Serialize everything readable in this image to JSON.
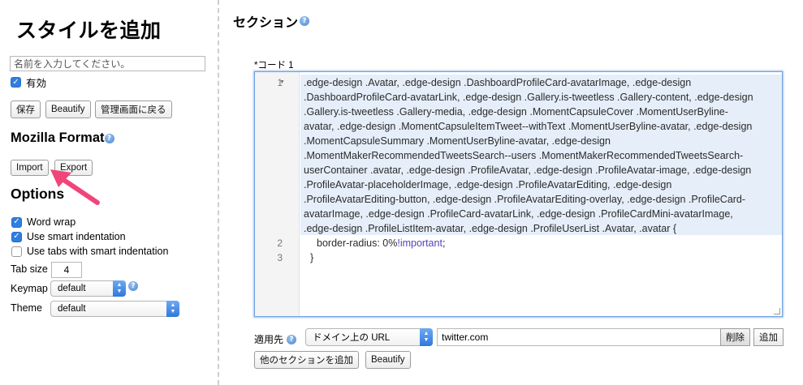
{
  "sidebar": {
    "title": "スタイルを追加",
    "name_placeholder": "名前を入力してください。",
    "enabled_label": "有効",
    "buttons": {
      "save": "保存",
      "beautify": "Beautify",
      "back": "管理画面に戻る"
    },
    "mozilla_format": {
      "heading": "Mozilla Format",
      "import": "Import",
      "export": "Export"
    },
    "options": {
      "heading": "Options",
      "word_wrap": "Word wrap",
      "smart_indent": "Use smart indentation",
      "tabs_smart_indent": "Use tabs with smart indentation",
      "tab_size_label": "Tab size",
      "tab_size_value": "4",
      "keymap_label": "Keymap",
      "keymap_value": "default",
      "theme_label": "Theme",
      "theme_value": "default"
    }
  },
  "main": {
    "title": "セクション",
    "code_label": "*コード 1",
    "line_numbers": [
      "1",
      "2",
      "3"
    ],
    "code_lines": [
      ".edge-design .Avatar, .edge-design .DashboardProfileCard-avatarImage, .edge-design",
      ".DashboardProfileCard-avatarLink, .edge-design .Gallery.is-tweetless .Gallery-content, .edge-design",
      ".Gallery.is-tweetless .Gallery-media, .edge-design .MomentCapsuleCover .MomentUserByline-",
      "avatar, .edge-design .MomentCapsuleItemTweet--withText .MomentUserByline-avatar, .edge-design",
      ".MomentCapsuleSummary .MomentUserByline-avatar, .edge-design",
      ".MomentMakerRecommendedTweetsSearch--users .MomentMakerRecommendedTweetsSearch-",
      "userContainer .avatar, .edge-design .ProfileAvatar, .edge-design .ProfileAvatar-image, .edge-design",
      ".ProfileAvatar-placeholderImage, .edge-design .ProfileAvatarEditing, .edge-design",
      ".ProfileAvatarEditing-button, .edge-design .ProfileAvatarEditing-overlay, .edge-design .ProfileCard-",
      "avatarImage, .edge-design .ProfileCard-avatarLink, .edge-design .ProfileCardMini-avatarImage,",
      ".edge-design .ProfileListItem-avatar, .edge-design .ProfileUserList .Avatar, .avatar {"
    ],
    "code_line2_prop": "border-radius: 0%",
    "code_line2_important": "!important",
    "code_line2_end": ";",
    "code_line3": "}",
    "applies_label": "適用先",
    "applies_type": "ドメイン上の URL",
    "applies_value": "twitter.com",
    "delete_label": "削除",
    "add_label": "追加",
    "add_section": "他のセクションを追加",
    "beautify": "Beautify"
  },
  "colors": {
    "accent": "#2f7ee0",
    "editor_selection": "#e6eef9",
    "pointer": "#f0457a",
    "important": "#5a3fbf"
  }
}
